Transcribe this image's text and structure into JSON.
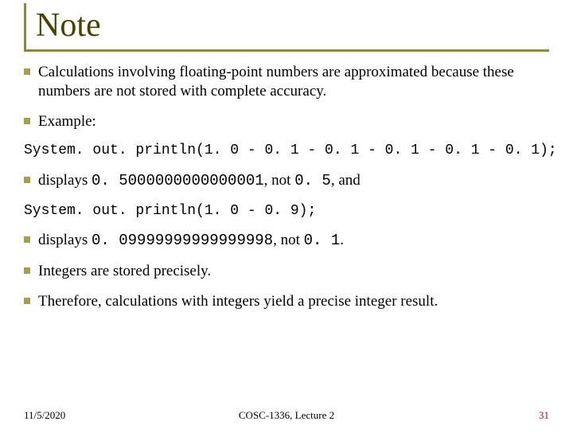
{
  "title": "Note",
  "bullets": {
    "b1": "Calculations involving floating-point numbers are approximated because these numbers are not stored with complete accuracy.",
    "b2": "Example:",
    "b3_pre": "displays ",
    "b3_code1": "0. 5000000000000001",
    "b3_mid": ", not ",
    "b3_code2": "0. 5",
    "b3_post": ", and",
    "b4_pre": "displays ",
    "b4_code1": "0. 09999999999999998",
    "b4_mid": ", not ",
    "b4_code2": "0. 1",
    "b4_post": ".",
    "b5": "Integers are stored precisely.",
    "b6": "Therefore, calculations with integers yield a precise integer result."
  },
  "code": {
    "line1": "System. out. println(1. 0 - 0. 1 - 0. 1 - 0. 1 - 0. 1 - 0. 1);",
    "line2": "System. out. println(1. 0 - 0. 9);"
  },
  "footer": {
    "date": "11/5/2020",
    "center": "COSC-1336, Lecture 2",
    "page": "31"
  }
}
